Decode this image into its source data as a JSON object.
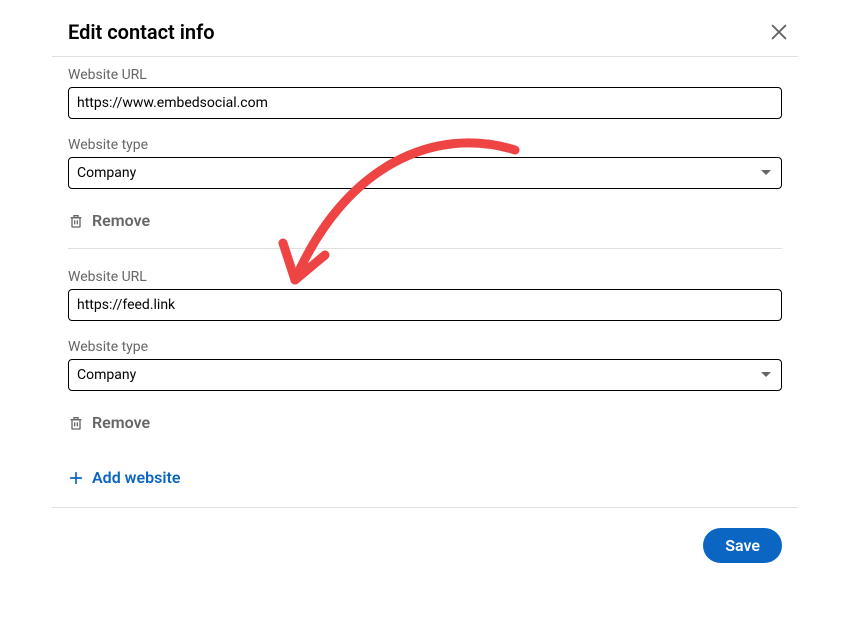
{
  "header": {
    "title": "Edit contact info"
  },
  "fields": {
    "url_label": "Website URL",
    "type_label": "Website type"
  },
  "websites": [
    {
      "url": "https://www.embedsocial.com",
      "type": "Company"
    },
    {
      "url": "https://feed.link",
      "type": "Company"
    }
  ],
  "actions": {
    "remove": "Remove",
    "add_website": "Add website",
    "save": "Save"
  }
}
